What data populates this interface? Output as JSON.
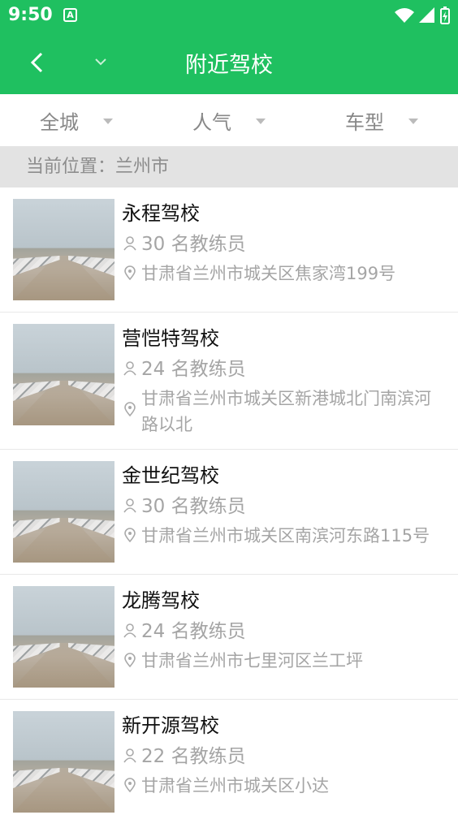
{
  "status_bar": {
    "time": "9:50",
    "app_badge": "A"
  },
  "header": {
    "title": "附近驾校"
  },
  "filters": [
    {
      "label": "全城"
    },
    {
      "label": "人气"
    },
    {
      "label": "车型"
    }
  ],
  "location": {
    "text": "当前位置：兰州市"
  },
  "schools": [
    {
      "name": "永程驾校",
      "coaches": "30 名教练员",
      "address": "甘肃省兰州市城关区焦家湾199号"
    },
    {
      "name": "营恺特驾校",
      "coaches": "24 名教练员",
      "address": "甘肃省兰州市城关区新港城北门南滨河路以北"
    },
    {
      "name": "金世纪驾校",
      "coaches": "30 名教练员",
      "address": "甘肃省兰州市城关区南滨河东路115号"
    },
    {
      "name": "龙腾驾校",
      "coaches": "24 名教练员",
      "address": "甘肃省兰州市七里河区兰工坪"
    },
    {
      "name": "新开源驾校",
      "coaches": "22 名教练员",
      "address": "甘肃省兰州市城关区小达"
    }
  ],
  "colors": {
    "brand": "#1fc060",
    "muted_text": "#a5a5a5"
  },
  "icons": {
    "back": "chevron-left-icon",
    "dropdown": "chevron-down-icon",
    "person": "person-icon",
    "location": "location-pin-icon"
  }
}
